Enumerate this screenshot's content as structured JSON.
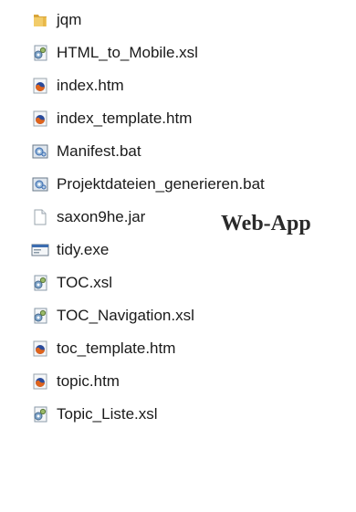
{
  "files": [
    {
      "name": "jqm",
      "icon": "folder-icon"
    },
    {
      "name": "HTML_to_Mobile.xsl",
      "icon": "xsl-file-icon"
    },
    {
      "name": "index.htm",
      "icon": "firefox-html-icon"
    },
    {
      "name": "index_template.htm",
      "icon": "firefox-html-icon"
    },
    {
      "name": "Manifest.bat",
      "icon": "batch-file-icon"
    },
    {
      "name": "Projektdateien_generieren.bat",
      "icon": "batch-file-icon"
    },
    {
      "name": "saxon9he.jar",
      "icon": "blank-file-icon"
    },
    {
      "name": "tidy.exe",
      "icon": "exe-file-icon"
    },
    {
      "name": "TOC.xsl",
      "icon": "xsl-file-icon"
    },
    {
      "name": "TOC_Navigation.xsl",
      "icon": "xsl-file-icon"
    },
    {
      "name": "toc_template.htm",
      "icon": "firefox-html-icon"
    },
    {
      "name": "topic.htm",
      "icon": "firefox-html-icon"
    },
    {
      "name": "Topic_Liste.xsl",
      "icon": "xsl-file-icon"
    }
  ],
  "overlay_label": "Web-App",
  "colors": {
    "folder": "#e8b84a",
    "firefox_orange": "#e0641c",
    "firefox_blue": "#2a4a9a",
    "batch_blue": "#3b6cb0"
  }
}
